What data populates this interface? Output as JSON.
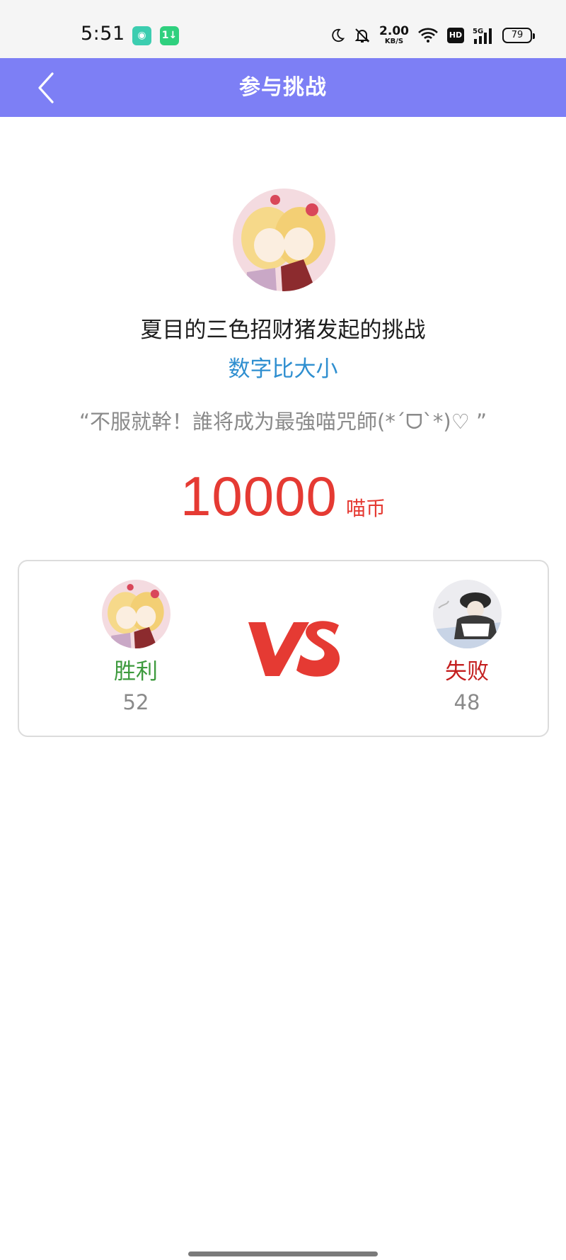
{
  "status_bar": {
    "time": "5:51",
    "app_badge_1": "◉",
    "app_badge_2": "1↓",
    "speed_value": "2.00",
    "speed_unit": "KB/S",
    "network": "5G",
    "hd": "HD",
    "battery": "79"
  },
  "header": {
    "title": "参与挑战",
    "accent_color": "#7d7ff5"
  },
  "challenge": {
    "initiator_text": "夏目的三色招财猪发起的挑战",
    "game_name": "数字比大小",
    "motto": "“不服就幹！誰将成为最強喵咒師(*ˊᗜˋ*)♡ ”",
    "wager_amount": "10000",
    "wager_unit": "喵币"
  },
  "result": {
    "left": {
      "label": "胜利",
      "score": "52",
      "color": "#3d9a3d"
    },
    "right": {
      "label": "失败",
      "score": "48",
      "color": "#c41f1f"
    },
    "vs_color": "#e53a33"
  },
  "icons": {
    "back": "chevron-left-icon",
    "moon": "moon-icon",
    "bell_off": "bell-off-icon",
    "wifi": "wifi-icon",
    "signal": "signal-icon"
  }
}
